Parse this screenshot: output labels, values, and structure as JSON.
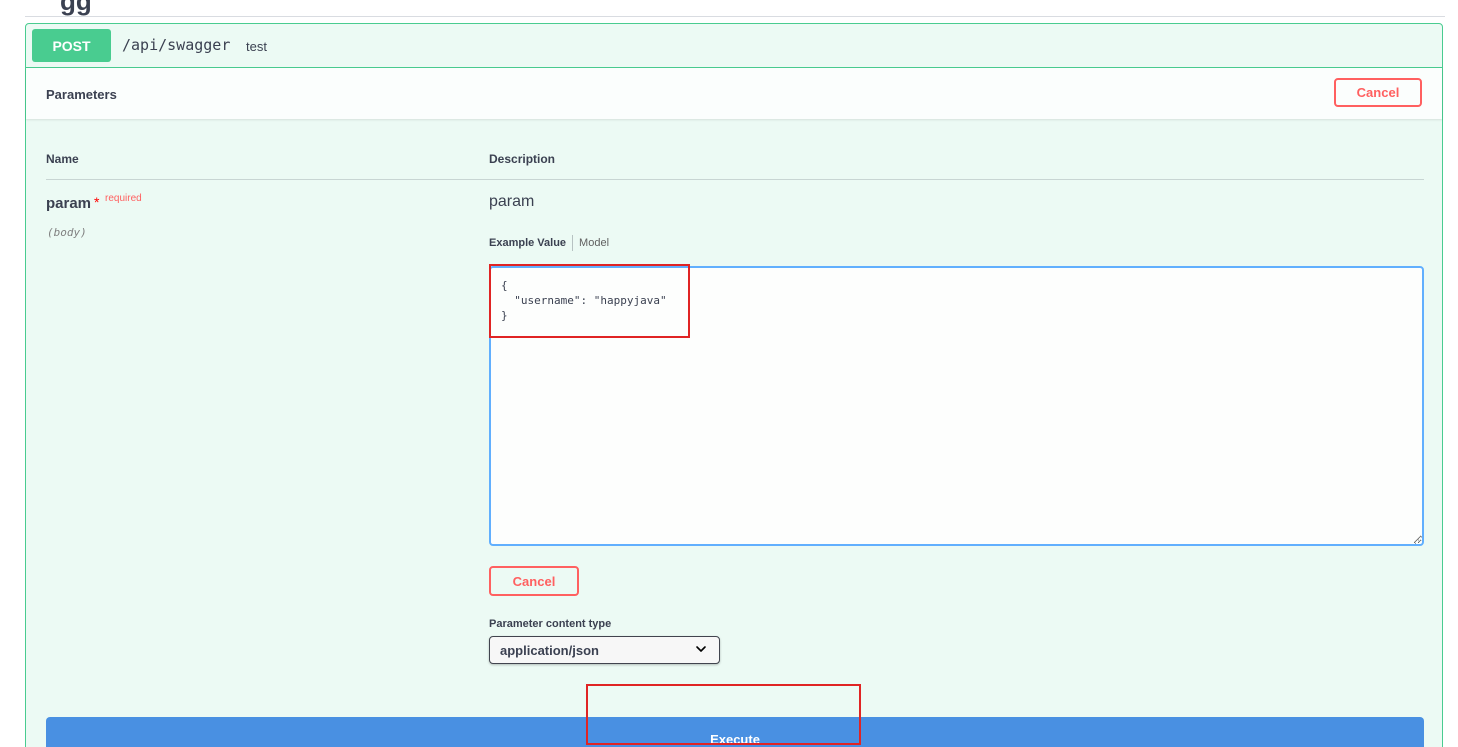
{
  "header": {
    "title_fragment": "gg"
  },
  "operation": {
    "method": "POST",
    "path": "/api/swagger",
    "summary": "test",
    "accent_color": "#49cc90"
  },
  "parameters": {
    "section_title": "Parameters",
    "cancel_label": "Cancel",
    "columns": {
      "name": "Name",
      "description": "Description"
    },
    "param": {
      "name": "param",
      "required_star": "*",
      "required_label": "required",
      "location": "(body)",
      "description": "param",
      "tabs": [
        "Example Value",
        "Model"
      ],
      "body_value": "{\n  \"username\": \"happyjava\"\n}",
      "cancel_label": "Cancel",
      "content_type_label": "Parameter content type",
      "content_type_value": "application/json"
    }
  },
  "execute": {
    "label": "Execute",
    "color": "#4990e2"
  },
  "colors": {
    "danger": "#ff6060",
    "annotation": "#e02424",
    "input_border": "#61affe"
  }
}
